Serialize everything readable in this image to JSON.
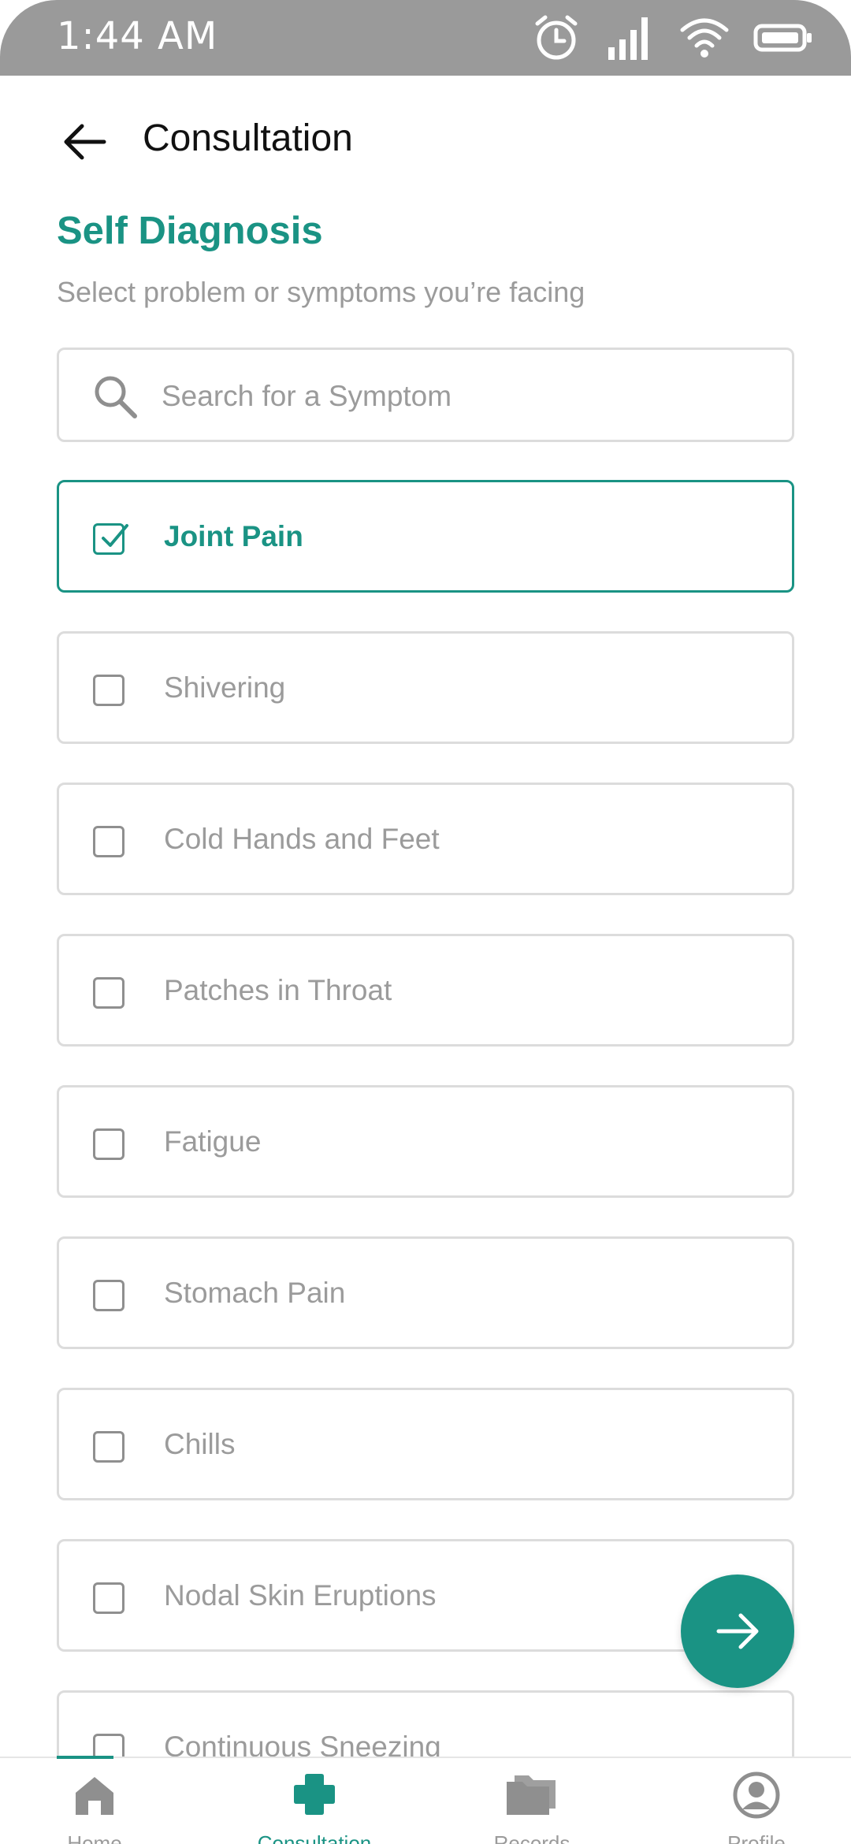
{
  "status_bar": {
    "time": "1:44 AM",
    "icons": [
      "alarm-icon",
      "signal-icon",
      "wifi-icon",
      "battery-icon"
    ]
  },
  "header": {
    "title": "Consultation",
    "back_icon": "arrow-left-icon"
  },
  "section": {
    "title": "Self Diagnosis",
    "subtitle": "Select problem or symptoms you’re facing"
  },
  "search": {
    "placeholder": "Search for a Symptom",
    "value": ""
  },
  "symptoms": [
    {
      "label": "Joint Pain",
      "checked": true
    },
    {
      "label": "Shivering",
      "checked": false
    },
    {
      "label": "Cold Hands and Feet",
      "checked": false
    },
    {
      "label": "Patches in Throat",
      "checked": false
    },
    {
      "label": "Fatigue",
      "checked": false
    },
    {
      "label": "Stomach Pain",
      "checked": false
    },
    {
      "label": "Chills",
      "checked": false
    },
    {
      "label": "Nodal Skin Eruptions",
      "checked": false
    },
    {
      "label": "Continuous Sneezing",
      "checked": false
    }
  ],
  "fab": {
    "icon": "arrow-right-icon"
  },
  "bottom_nav": {
    "items": [
      {
        "label": "Home",
        "icon": "home-icon",
        "active": false
      },
      {
        "label": "Consultation",
        "icon": "medical-cross-icon",
        "active": true
      },
      {
        "label": "Records",
        "icon": "folder-icon",
        "active": false
      },
      {
        "label": "Profile",
        "icon": "profile-icon",
        "active": false
      }
    ]
  },
  "colors": {
    "accent": "#1a9384",
    "status_bar": "#9a9a9a",
    "muted_text": "#9b9b9b",
    "border": "#dcdcdc"
  }
}
